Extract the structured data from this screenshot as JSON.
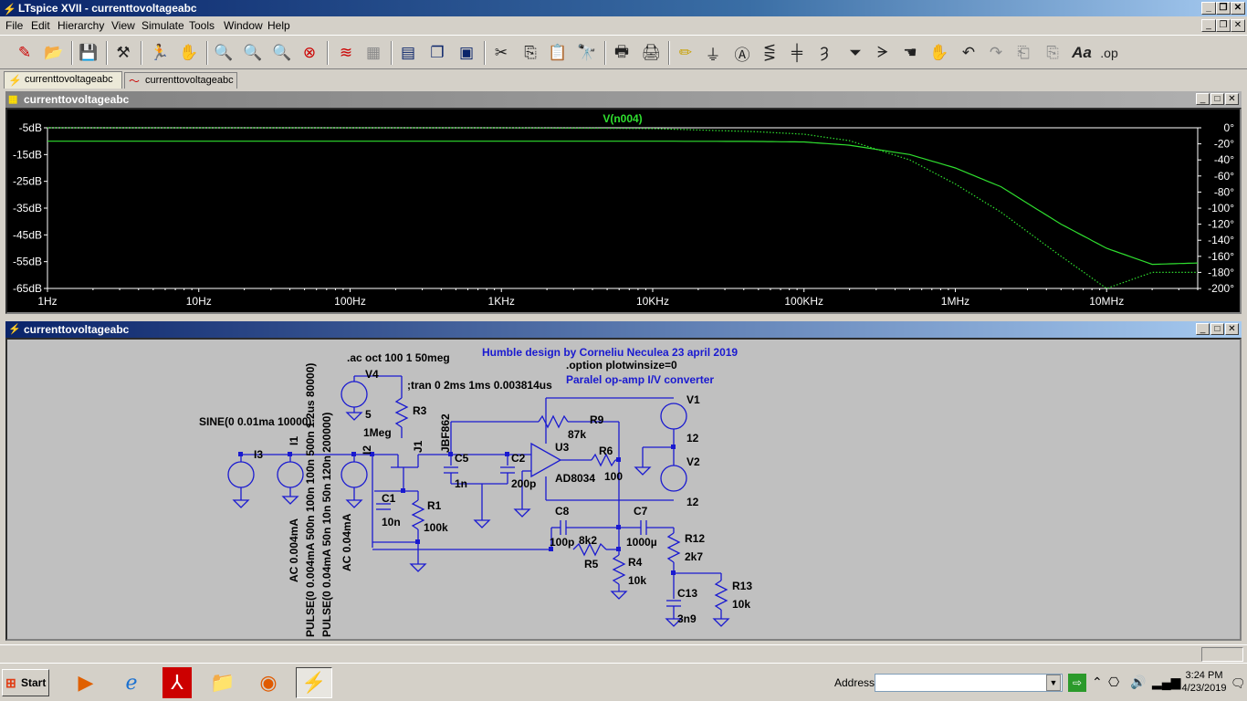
{
  "window": {
    "title": "LTspice XVII - currenttovoltageabc"
  },
  "menu": [
    "File",
    "Edit",
    "Hierarchy",
    "View",
    "Simulate",
    "Tools",
    "Window",
    "Help"
  ],
  "toolbar": {
    "icons": [
      "new-schematic-icon",
      "open-icon",
      "save-icon",
      "control-panel-icon",
      "run-icon",
      "halt-icon",
      "zoom-in-icon",
      "zoom-pan-icon",
      "zoom-out-icon",
      "zoom-fit-icon",
      "autorange-icon",
      "grid-icon",
      "tile-icon",
      "cascade-icon",
      "close-all-icon",
      "cut-icon",
      "copy-icon",
      "paste-icon",
      "find-icon",
      "print-icon",
      "print-setup-icon",
      "draw-wire-icon",
      "ground-icon",
      "label-net-icon",
      "resistor-icon",
      "capacitor-icon",
      "inductor-icon",
      "diode-icon",
      "component-icon",
      "move-icon",
      "drag-icon",
      "undo-icon",
      "redo-icon",
      "rotate-icon",
      "mirror-icon",
      "text-icon",
      "spice-directive-icon"
    ],
    "op_label": ".op",
    "text_label": "Aa"
  },
  "tabs": [
    {
      "label": "currenttovoltageabc"
    },
    {
      "label": "currenttovoltageabc"
    }
  ],
  "plot_window": {
    "title": "currenttovoltageabc"
  },
  "schematic_window": {
    "title": "currenttovoltageabc"
  },
  "chart_data": {
    "type": "line",
    "title": "V(n004)",
    "x": [
      "1Hz",
      "10Hz",
      "100Hz",
      "1KHz",
      "10KHz",
      "100KHz",
      "1MHz",
      "10MHz"
    ],
    "xscale": "log",
    "xlim": [
      "1Hz",
      "40MHz"
    ],
    "ylabel_left_ticks": [
      "-5dB",
      "-15dB",
      "-25dB",
      "-35dB",
      "-45dB",
      "-55dB",
      "-65dB"
    ],
    "ylabel_right_ticks": [
      "0°",
      "-20°",
      "-40°",
      "-60°",
      "-80°",
      "-100°",
      "-120°",
      "-140°",
      "-160°",
      "-180°",
      "-200°"
    ],
    "ylim_left": [
      -65,
      -5
    ],
    "ylim_right": [
      -200,
      0
    ],
    "series": [
      {
        "name": "V(n004)",
        "kind": "magnitude",
        "freq_hz": [
          1,
          10,
          100,
          1000,
          10000,
          50000,
          100000,
          200000,
          500000,
          1000000,
          2000000,
          5000000,
          10000000,
          20000000,
          40000000
        ],
        "db": [
          -10,
          -10,
          -10,
          -10,
          -10,
          -10.1,
          -10.3,
          -11.5,
          -15,
          -20,
          -27,
          -41,
          -50,
          -56,
          -55.5
        ]
      },
      {
        "name": "V(n004)",
        "kind": "phase",
        "freq_hz": [
          1,
          10,
          100,
          1000,
          10000,
          50000,
          100000,
          200000,
          500000,
          1000000,
          2000000,
          5000000,
          10000000,
          20000000,
          40000000
        ],
        "deg": [
          0,
          0,
          0,
          0,
          -1,
          -5,
          -8,
          -16,
          -40,
          -70,
          -105,
          -160,
          -200,
          -180,
          -180
        ]
      }
    ],
    "grid": false,
    "colors": {
      "trace": "#2fdf2f",
      "background": "#000000",
      "axis": "#ffffff"
    }
  },
  "schematic": {
    "directives": [
      ".ac oct 100 1 50meg",
      ";tran 0 2ms 1ms 0.003814us",
      ".option plotwinsize=0"
    ],
    "comments": [
      "Humble design by Corneliu Neculea 23 april 2019",
      "Paralel op-amp I/V converter"
    ],
    "sources": {
      "I3_func": "SINE(0 0.01ma 10000)",
      "I1_func": "PULSE(0 0.004mA 500n 100n 100n 500n 1.2us 80000)",
      "I2_func": "PULSE(0 0.04mA 50n 10n 50n 120n 200000)",
      "I1_ac": "AC 0.004mA",
      "I2_ac": "AC 0.04mA"
    },
    "labels": {
      "V4": "V4",
      "V4_val": "5",
      "R3": "R3",
      "R3_val": "1Meg",
      "I3": "I3",
      "I1": "I1",
      "I2": "I2",
      "J1": "J1",
      "J1_model": "JBF862",
      "C5": "C5",
      "C5_val": "1n",
      "C2": "C2",
      "C2_val": "200p",
      "U3": "U3",
      "U3_model": "AD8034",
      "R9": "R9",
      "R9_val": "87k",
      "R6": "R6",
      "R6_val": "100",
      "V1": "V1",
      "V1_val": "12",
      "V2": "V2",
      "V2_val": "12",
      "C1": "C1",
      "C1_val": "10n",
      "R1": "R1",
      "R1_val": "100k",
      "C8": "C8",
      "C8_val": "100p",
      "R5": "R5",
      "R5_val": "8k2",
      "C7": "C7",
      "C7_val": "1000µ",
      "R4": "R4",
      "R4_val": "10k",
      "R12": "R12",
      "R12_val": "2k7",
      "C13": "C13",
      "C13_val": "3n9",
      "R13": "R13",
      "R13_val": "10k"
    }
  },
  "taskbar": {
    "start_label": "Start",
    "apps": [
      "media-player-icon",
      "internet-explorer-icon",
      "acrobat-icon",
      "file-explorer-icon",
      "firefox-icon",
      "ltspice-icon"
    ],
    "address_label": "Address",
    "address_value": "",
    "time": "3:24 PM",
    "date": "4/23/2019"
  }
}
